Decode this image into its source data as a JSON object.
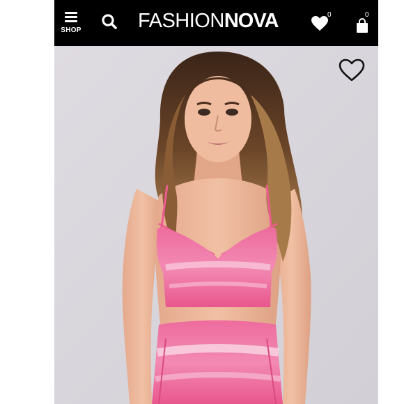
{
  "header": {
    "shop_label": "SHOP",
    "logo_light": "FASHION",
    "logo_bold": "NOVA",
    "wishlist_count": "0",
    "cart_count": "0"
  },
  "icons": {
    "menu": "hamburger-menu-icon",
    "search": "search-icon",
    "wishlist": "heart-filled-icon",
    "cart": "shopping-bag-icon",
    "favorite": "heart-outline-icon"
  },
  "product": {
    "image_alt": "Model wearing pink tie-dye strappy crop top and matching skirt"
  },
  "colors": {
    "header_bg": "#000000",
    "photo_bg": "#d9d6dc",
    "garment_pink": "#ec5c91"
  }
}
